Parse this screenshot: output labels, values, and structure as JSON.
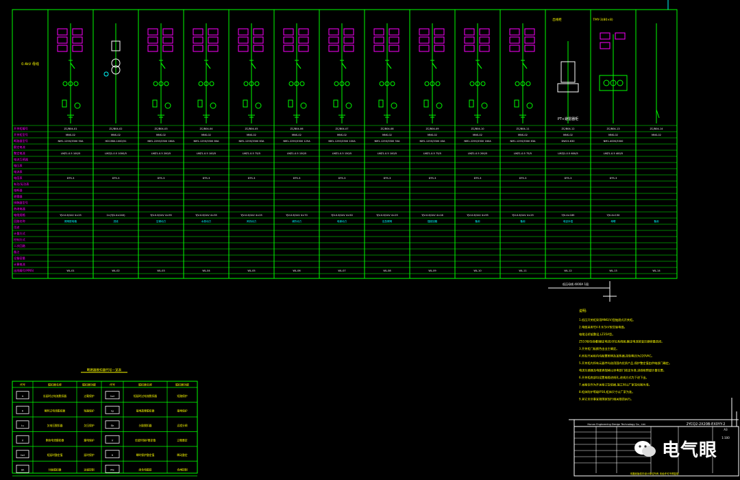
{
  "title_block": {
    "drawing_no": "2YCQ2-2X20B-EX0YY-2",
    "company": "Hunan Engineering Design Technology Co., Ltd.",
    "scale": "1:100",
    "sheet": "A3",
    "footer": "本图纸版权归设计单位所有 未经许可不得复制"
  },
  "watermark": "电气眼",
  "bus_label": "0.4kV 母线",
  "panel_headers": [
    "出线柜",
    "进线柜",
    "TMY-3(80×8)"
  ],
  "row_labels": [
    "开关柜编号",
    "开关柜型号",
    "断路器型号",
    "额定电流",
    "整定电流",
    "电流互感器",
    "电压表",
    "电流表",
    "电度表",
    "有功/无功表",
    "熔断器",
    "避雷器",
    "接触器型号",
    "热继电器",
    "电缆规格",
    "回路名称",
    "用途",
    "计量方式",
    "控制方式",
    "二次回路",
    "备注",
    "设备容量",
    "计算电流",
    "出线编号(MNS)"
  ],
  "columns": [
    {
      "id": "ZC/B04-01",
      "model": "MNS-02",
      "breaker": "NM1-125S/3300 50A",
      "ct": "LMZ1-0.5 100/5",
      "meter": "DTS-3",
      "cable": "YJV-0.6/1kV 4×25",
      "load": "照明配电箱",
      "spare": "WL-01"
    },
    {
      "id": "ZC/B04-02",
      "model": "MNS-02",
      "breaker": "HD13BX-1000/31",
      "ct": "LMZJ1-0.5 1000/5",
      "meter": "DTS-3",
      "cable": "2×(YJV-4×240)",
      "load": "进线",
      "spare": "WL-02"
    },
    {
      "id": "ZC/B04-03",
      "model": "MNS-02",
      "breaker": "NM1-225S/3300 160A",
      "ct": "LMZ1-0.5 200/5",
      "meter": "DTS-3",
      "cable": "YJV-0.6/1kV 4×95",
      "load": "空调动力",
      "spare": "WL-03"
    },
    {
      "id": "ZC/B04-04",
      "model": "MNS-02",
      "breaker": "NM1-125S/3300 80A",
      "ct": "LMZ1-0.5 100/5",
      "meter": "DTS-3",
      "cable": "YJV-0.6/1kV 4×35",
      "load": "水泵动力",
      "spare": "WL-04"
    },
    {
      "id": "ZC/B04-05",
      "model": "MNS-02",
      "breaker": "NM1-125S/3300 63A",
      "ct": "LMZ1-0.5 75/5",
      "meter": "DTS-3",
      "cable": "YJV-0.6/1kV 4×25",
      "load": "风机动力",
      "spare": "WL-05"
    },
    {
      "id": "ZC/B04-06",
      "model": "MNS-02",
      "breaker": "NM1-225S/3300 125A",
      "ct": "LMZ1-0.5 150/5",
      "meter": "DTS-3",
      "cable": "YJV-0.6/1kV 4×70",
      "load": "消防动力",
      "spare": "WL-06"
    },
    {
      "id": "ZC/B04-07",
      "model": "MNS-02",
      "breaker": "NM1-125S/3300 100A",
      "ct": "LMZ1-0.5 150/5",
      "meter": "DTS-3",
      "cable": "YJV-0.6/1kV 4×50",
      "load": "电梯动力",
      "spare": "WL-07"
    },
    {
      "id": "ZC/B04-08",
      "model": "MNS-02",
      "breaker": "NM1-125S/3300 50A",
      "ct": "LMZ1-0.5 100/5",
      "meter": "DTS-3",
      "cable": "YJV-0.6/1kV 4×25",
      "load": "应急照明",
      "spare": "WL-08"
    },
    {
      "id": "ZC/B04-09",
      "model": "MNS-02",
      "breaker": "NM1-125S/3300 40A",
      "ct": "LMZ1-0.5 75/5",
      "meter": "DTS-3",
      "cable": "YJV-0.6/1kV 4×16",
      "load": "插座回路",
      "spare": "WL-09"
    },
    {
      "id": "ZC/B04-10",
      "model": "MNS-02",
      "breaker": "NM1-225S/3300 160A",
      "ct": "LMZ1-0.5 200/5",
      "meter": "DTS-3",
      "cable": "YJV-0.6/1kV 4×95",
      "load": "备用",
      "spare": "WL-10"
    },
    {
      "id": "ZC/B04-11",
      "model": "MNS-02",
      "breaker": "NM1-125S/3300 63A",
      "ct": "LMZ1-0.5 75/5",
      "meter": "DTS-3",
      "cable": "YJV-0.6/1kV 4×25",
      "load": "备用",
      "spare": "WL-11"
    },
    {
      "id": "ZC/B04-12",
      "model": "MNS-02",
      "breaker": "DW15-630",
      "ct": "LMZJ1-0.5 600/5",
      "meter": "DTS-3",
      "cable": "YJV-4×185",
      "load": "电容补偿",
      "spare": "WL-12"
    },
    {
      "id": "ZC/B04-13",
      "model": "MNS-02",
      "breaker": "NM1-400S/3300",
      "ct": "LMZ1-0.5 400/5",
      "meter": "DTS-3",
      "cable": "YJV-4×150",
      "load": "母联",
      "spare": "WL-13"
    },
    {
      "id": "ZC/B04-14",
      "model": "MNS-02",
      "breaker": "",
      "ct": "",
      "meter": "",
      "cable": "",
      "load": "备用",
      "spare": "WL-14"
    }
  ],
  "notes": {
    "heading": "说明:",
    "items": [
      "1.低压开关柜采用MNS(V)型抽屉式开关柜。",
      "2.电缆采用YJV-0.6/1kV型交联电缆。",
      "  电缆沿桥架敷设,LZ35A型。",
      "  ZS10型母线槽(额定电流)详见系统图,额定电流按变压器容量选择。",
      "3.开关柜门板颜色由业主确定。",
      "4.所有开关柜内均配置照明及加热器,控制电压为220VAC。",
      "5.开关柜内所有元器件均选用国内优质产品,保护整定值由供电部门确定。",
      "  电流互感器及电能表规格以供电部门核定为准,进线柜预留计量位置。",
      "6.开关柜底部均设置电缆进线孔,进线方式为下进下出。",
      "7.本图仅作为开关柜订货依据,施工时以厂家深化图为准。",
      "8.柜体防护等级IP30,柜体尺寸以厂家为准。",
      "9.其它未尽事宜按国家现行相关规范执行。"
    ]
  },
  "bus_note": "低压母线 4000A 1段",
  "legend": {
    "title": "断路器脱扣器代号一览表",
    "headers": [
      "代号",
      "脱扣器名称",
      "脱扣器功能",
      "代号",
      "脱扣器名称",
      "脱扣器功能"
    ],
    "rows": [
      [
        "Ir",
        "长延时过电流脱扣器",
        "过载保护",
        "Isd",
        "短延时过电流脱扣器",
        "短路保护"
      ],
      [
        "Ii",
        "瞬时过电流脱扣器",
        "短路保护",
        "Ig",
        "接地故障脱扣器",
        "接地保护"
      ],
      [
        "Iu",
        "欠电压脱扣器",
        "欠压保护",
        "Sh",
        "分励脱扣器",
        "远程分闸"
      ],
      [
        "Ir",
        "剩余电流脱扣器",
        "漏电保护",
        "Ir",
        "长延时保护整定值",
        "过载整定"
      ],
      [
        "Isd",
        "短延时整定值",
        "延时保护",
        "Ii",
        "瞬时保护整定值",
        "瞬动整定"
      ],
      [
        "Sh",
        "分励脱扣器",
        "远程控制",
        "Mx",
        "闭合电磁铁",
        "合闸控制"
      ]
    ]
  }
}
